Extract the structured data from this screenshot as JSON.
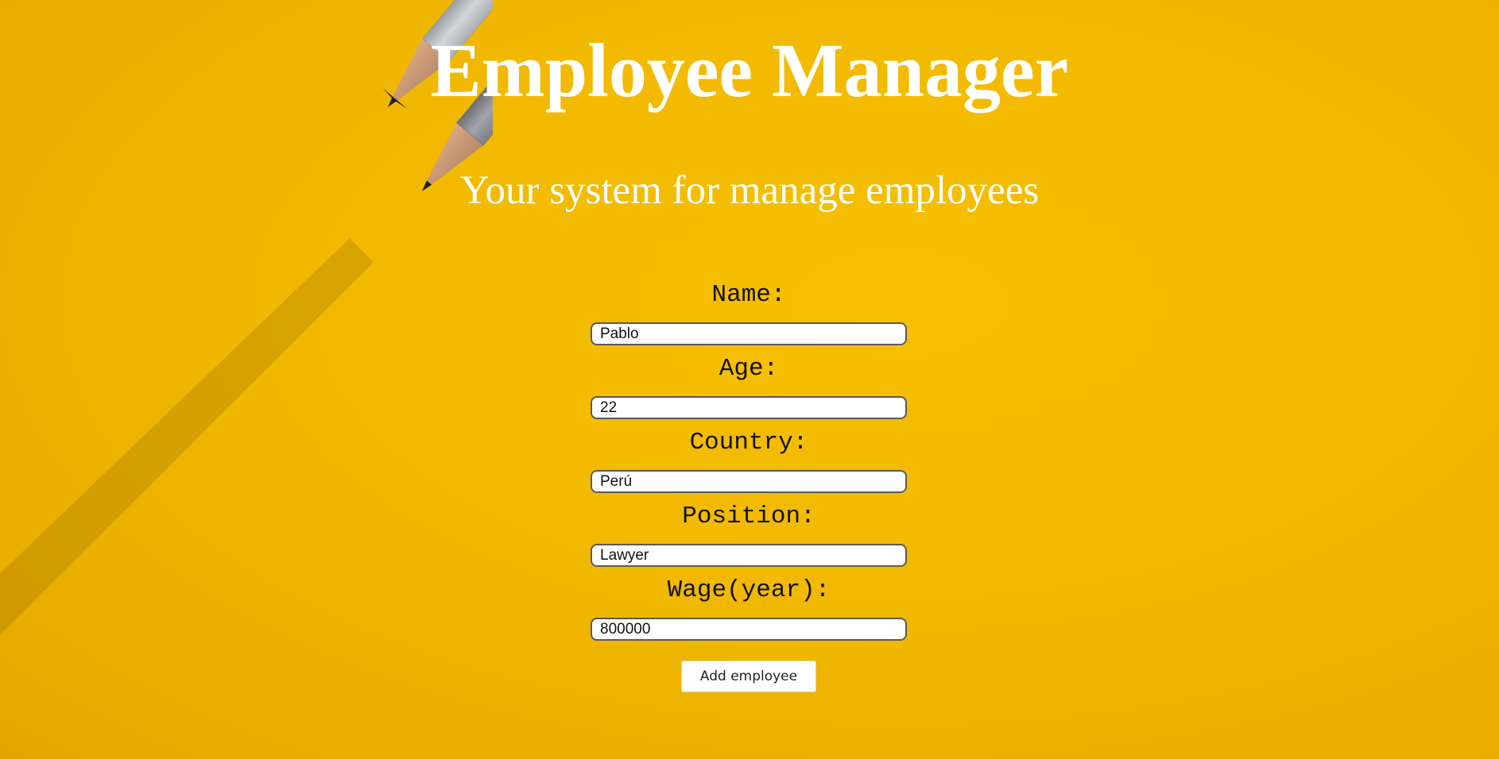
{
  "header": {
    "title": "Employee Manager",
    "subtitle": "Your system for manage employees"
  },
  "form": {
    "fields": [
      {
        "label": "Name:",
        "value": "Pablo"
      },
      {
        "label": "Age:",
        "value": "22"
      },
      {
        "label": "Country:",
        "value": "Perú"
      },
      {
        "label": "Position:",
        "value": "Lawyer"
      },
      {
        "label": "Wage(year):",
        "value": "800000"
      }
    ],
    "submit_label": "Add employee"
  },
  "decoration": {
    "background_color": "#f2b900",
    "image_subject": "pencils-icon"
  }
}
